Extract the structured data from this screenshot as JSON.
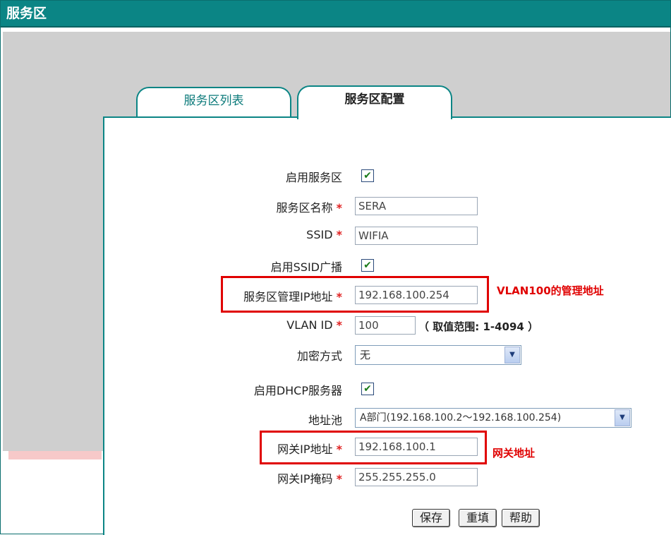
{
  "window": {
    "title": "服务区"
  },
  "tabs": [
    {
      "label": "服务区列表",
      "active": false
    },
    {
      "label": "服务区配置",
      "active": true
    }
  ],
  "form": {
    "enable_service_area": {
      "label": "启用服务区",
      "checked": true
    },
    "service_area_name": {
      "label": "服务区名称",
      "required_mark": "*",
      "value": "SERA"
    },
    "ssid": {
      "label": "SSID",
      "required_mark": "*",
      "value": "WIFIA"
    },
    "enable_ssid_broadcast": {
      "label": "启用SSID广播",
      "checked": true
    },
    "mgmt_ip": {
      "label": "服务区管理IP地址",
      "required_mark": "*",
      "value": "192.168.100.254"
    },
    "vlan_id": {
      "label": "VLAN ID",
      "required_mark": "*",
      "value": "100",
      "range_hint": "（ 取值范围: 1-4094 ）"
    },
    "encryption": {
      "label": "加密方式",
      "selected": "无"
    },
    "enable_dhcp": {
      "label": "启用DHCP服务器",
      "checked": true
    },
    "address_pool": {
      "label": "地址池",
      "selected": "A部门(192.168.100.2～192.168.100.254)"
    },
    "gateway_ip": {
      "label": "网关IP地址",
      "required_mark": "*",
      "value": "192.168.100.1"
    },
    "gateway_mask": {
      "label": "网关IP掩码",
      "required_mark": "*",
      "value": "255.255.255.0"
    }
  },
  "annotations": {
    "mgmt_note": "VLAN100的管理地址",
    "gateway_note": "网关地址"
  },
  "buttons": {
    "save": "保存",
    "reset": "重填",
    "help": "帮助"
  },
  "icons": {
    "checkbox": "check-icon",
    "dropdown": "chevron-down-icon"
  },
  "colors": {
    "titlebar": "#0b8585",
    "accent_red": "#e00000",
    "required": "#e02020"
  }
}
